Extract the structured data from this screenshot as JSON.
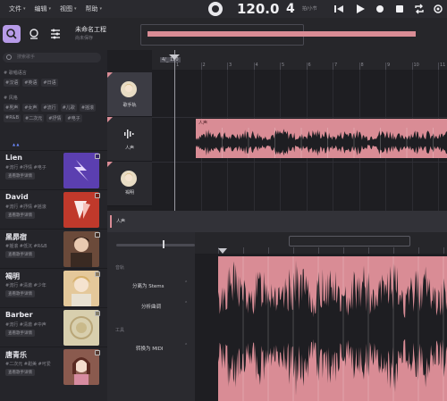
{
  "menubar": {
    "items": [
      {
        "label": "文件"
      },
      {
        "label": "编辑"
      },
      {
        "label": "视图"
      },
      {
        "label": "帮助"
      }
    ]
  },
  "transport": {
    "tempo": "120.0",
    "meter": "4",
    "meter_unit": "拍/小节"
  },
  "project": {
    "title": "未命名工程",
    "subtitle": "尚未保存"
  },
  "browser": {
    "search_placeholder": "搜索歌手",
    "language_section": "# 歌唱语言",
    "language_tags": [
      "#汉语",
      "#英语",
      "#日语"
    ],
    "style_section": "# 风格",
    "style_tags": [
      "#男声",
      "#女声",
      "#流行",
      "#儿歌",
      "#摇滚",
      "#R&B",
      "#二次元",
      "#抒情",
      "#电子"
    ],
    "artists": [
      {
        "name": "Lien",
        "tags": "#流行 #抒情 #电子",
        "button": "查看歌手详情",
        "color": "#5b3fb0"
      },
      {
        "name": "David",
        "tags": "#流行 #抒情 #摇滚",
        "button": "查看歌手详情",
        "color": "#c0392b"
      },
      {
        "name": "黑昴宿",
        "tags": "#摇滚 #低沉 #R&B",
        "button": "查看歌手详情",
        "color": "#6b4a3a"
      },
      {
        "name": "褐明",
        "tags": "#流行 #清澈 #少年",
        "button": "查看歌手详情",
        "color": "#e4c89a"
      },
      {
        "name": "Barber",
        "tags": "#流行 #清澈 #中声",
        "button": "查看歌手详情",
        "color": "#d8cfae"
      },
      {
        "name": "唐青乐",
        "tags": "#二次元 #甜美 #可爱",
        "button": "查看歌手详情",
        "color": "#8a5a4e"
      }
    ]
  },
  "tracks": [
    {
      "label": "歌手轨"
    },
    {
      "label": "人声"
    },
    {
      "label": "褐明"
    }
  ],
  "timeline": {
    "marker": "4/_ 120",
    "bar_numbers": [
      "1",
      "2",
      "3",
      "4",
      "5",
      "6",
      "7",
      "8",
      "9",
      "10",
      "11"
    ],
    "clip_label": "人声"
  },
  "editor": {
    "title": "人声",
    "section_stems": "音轨",
    "action_split": "分离为 Stems",
    "action_analyze": "分析曲调",
    "section_tools": "工具",
    "action_midi": "转换为 MIDI"
  },
  "colors": {
    "accent_purple": "#b79be8",
    "clip_pink": "#d98c95",
    "background": "#1f1f23"
  }
}
